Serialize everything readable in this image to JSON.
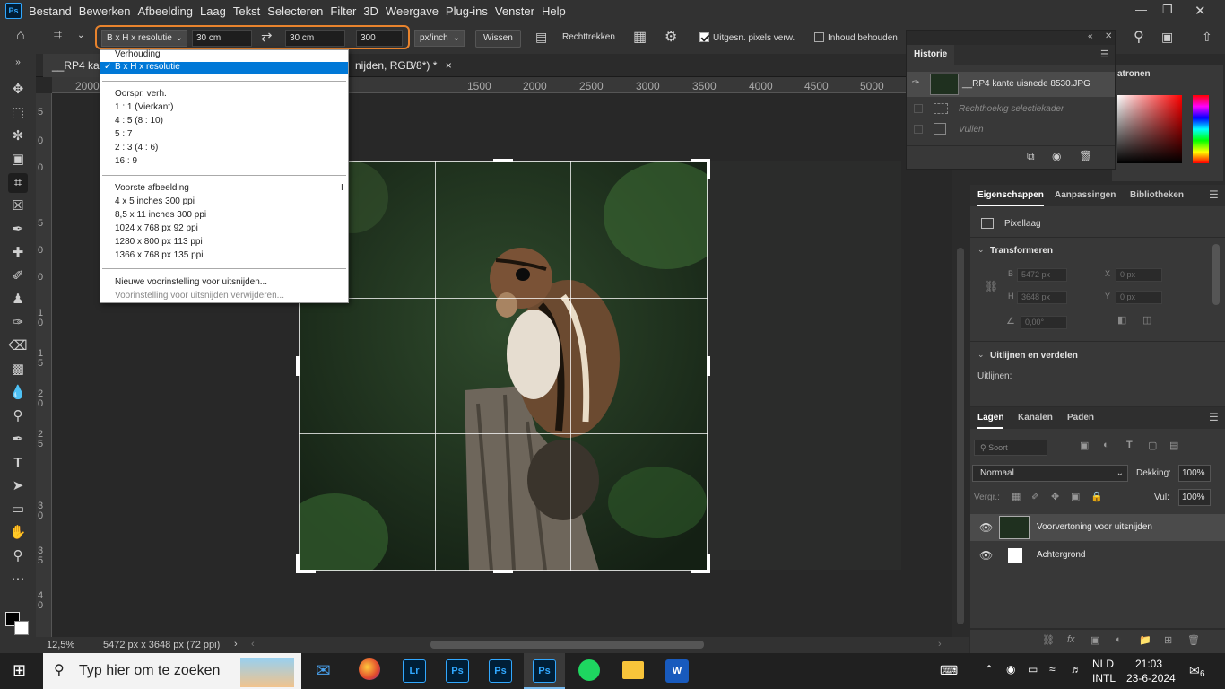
{
  "menubar": {
    "logo": "Ps",
    "items": [
      "Bestand",
      "Bewerken",
      "Afbeelding",
      "Laag",
      "Tekst",
      "Selecteren",
      "Filter",
      "3D",
      "Weergave",
      "Plug-ins",
      "Venster",
      "Help"
    ]
  },
  "options": {
    "preset": "B x H x resolutie",
    "width": "30 cm",
    "height": "30 cm",
    "resolution": "300",
    "unit": "px/inch",
    "clear": "Wissen",
    "straighten": "Rechttrekken",
    "delete_pixels": "Uitgesn. pixels verw.",
    "content_aware": "Inhoud behouden"
  },
  "document": {
    "tab_title": "__RP4 kante",
    "tab_tail": "nijden, RGB/8*) *",
    "zoom": "12,5%",
    "doc_info": "5472 px x 3648 px (72 ppi)"
  },
  "ruler_h": [
    "2000",
    "1500",
    "2000",
    "2500",
    "3000",
    "3500",
    "4000",
    "4500",
    "5000"
  ],
  "ruler_v": [
    "5",
    "0",
    "0",
    "5",
    "0",
    "0",
    "1 0",
    "1 5",
    "2 0",
    "2 5",
    "3 0",
    "3 5",
    "4 0"
  ],
  "crop_menu": {
    "header": "Verhouding",
    "selected": "B x H x resolutie",
    "group1": [
      "Oorspr. verh.",
      "1 : 1 (Vierkant)",
      "4 : 5 (8 : 10)",
      "5 : 7",
      "2 : 3 (4 : 6)",
      "16 : 9"
    ],
    "group2": [
      "Voorste afbeelding",
      "4 x 5 inches 300 ppi",
      "8,5 x 11 inches 300 ppi",
      "1024 x 768 px 92 ppi",
      "1280 x 800 px 113 ppi",
      "1366 x 768 px 135 ppi"
    ],
    "new_preset": "Nieuwe voorinstelling voor uitsnijden...",
    "delete_preset": "Voorinstelling voor uitsnijden verwijderen..."
  },
  "history": {
    "title": "Historie",
    "snapshot": "__RP4 kante uisnede 8530.JPG",
    "steps": [
      "Rechthoekig selectiekader",
      "Vullen"
    ]
  },
  "swatches_tab": "atronen",
  "properties": {
    "tabs": [
      "Eigenschappen",
      "Aanpassingen",
      "Bibliotheken"
    ],
    "layer_type": "Pixellaag",
    "transform_title": "Transformeren",
    "w_label": "B",
    "w_value": "5472 px",
    "h_label": "H",
    "h_value": "3648 px",
    "x_label": "X",
    "x_value": "0 px",
    "y_label": "Y",
    "y_value": "0 px",
    "angle": "0,00°",
    "align_title": "Uitlijnen en verdelen",
    "align_label": "Uitlijnen:"
  },
  "layers": {
    "tabs": [
      "Lagen",
      "Kanalen",
      "Paden"
    ],
    "filter": "Soort",
    "blend": "Normaal",
    "opacity_label": "Dekking:",
    "opacity": "100%",
    "lock_label": "Vergr.:",
    "fill_label": "Vul:",
    "fill": "100%",
    "items": [
      "Voorvertoning voor uitsnijden",
      "Achtergrond"
    ]
  },
  "taskbar": {
    "search": "Typ hier om te zoeken",
    "apps": [
      {
        "label": "Lr",
        "bg": "#001e36",
        "fg": "#31a8ff"
      },
      {
        "label": "Ps",
        "bg": "#001e36",
        "fg": "#31a8ff"
      },
      {
        "label": "Ps",
        "bg": "#001e36",
        "fg": "#31a8ff"
      },
      {
        "label": "Ps",
        "bg": "#001e36",
        "fg": "#31a8ff"
      },
      {
        "label": "W",
        "bg": "#185abd",
        "fg": "#ffffff"
      }
    ],
    "lang1": "NLD",
    "lang2": "INTL",
    "time": "21:03",
    "date": "23-6-2024",
    "notifications": "6"
  },
  "colors": {
    "accent": "#0078d7",
    "highlight": "#e8832d"
  }
}
